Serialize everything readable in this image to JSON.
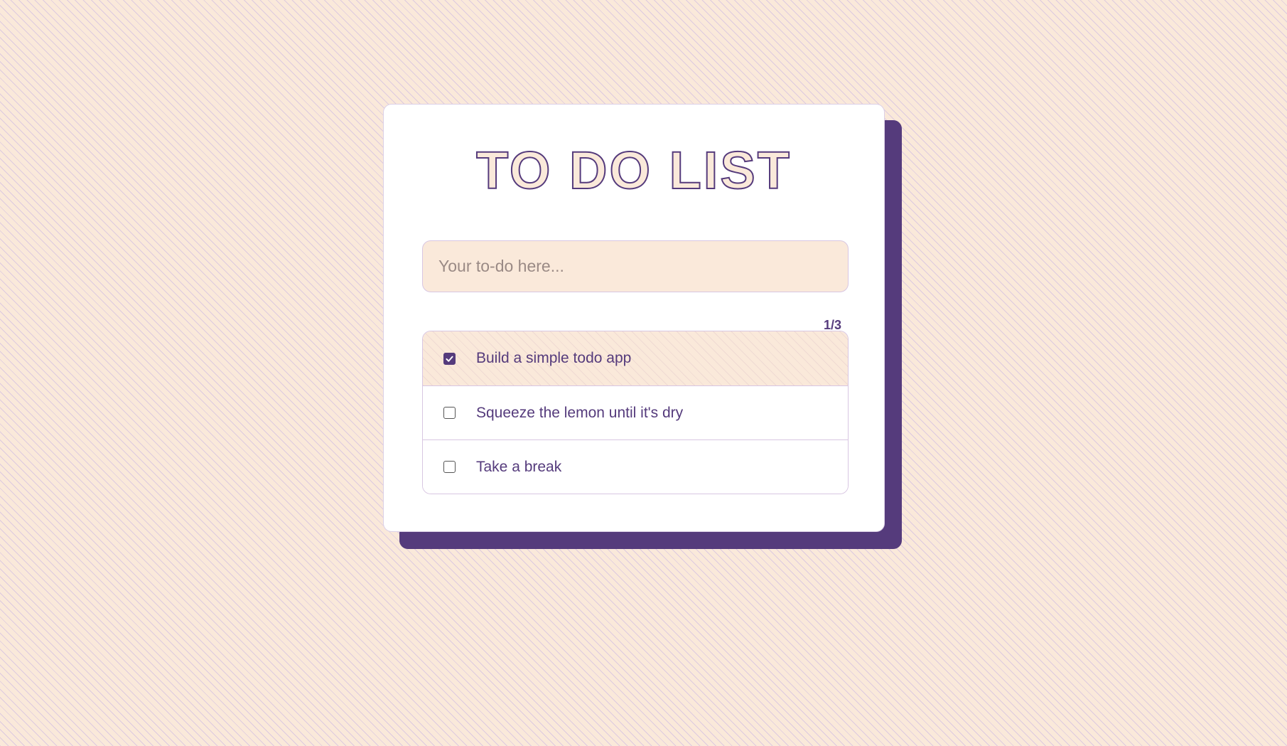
{
  "app": {
    "title": "TO DO LIST"
  },
  "input": {
    "placeholder": "Your to-do here...",
    "value": ""
  },
  "counter": {
    "text": "1/3"
  },
  "todos": [
    {
      "label": "Build a simple todo app",
      "done": true
    },
    {
      "label": "Squeeze the lemon until it's dry",
      "done": false
    },
    {
      "label": "Take a break",
      "done": false
    }
  ],
  "colors": {
    "accent": "#553b7c",
    "background": "#fae9da",
    "card": "#ffffff",
    "border": "#d8c6e2"
  },
  "icons": {
    "checkbox_checked": "checkmark-icon"
  }
}
